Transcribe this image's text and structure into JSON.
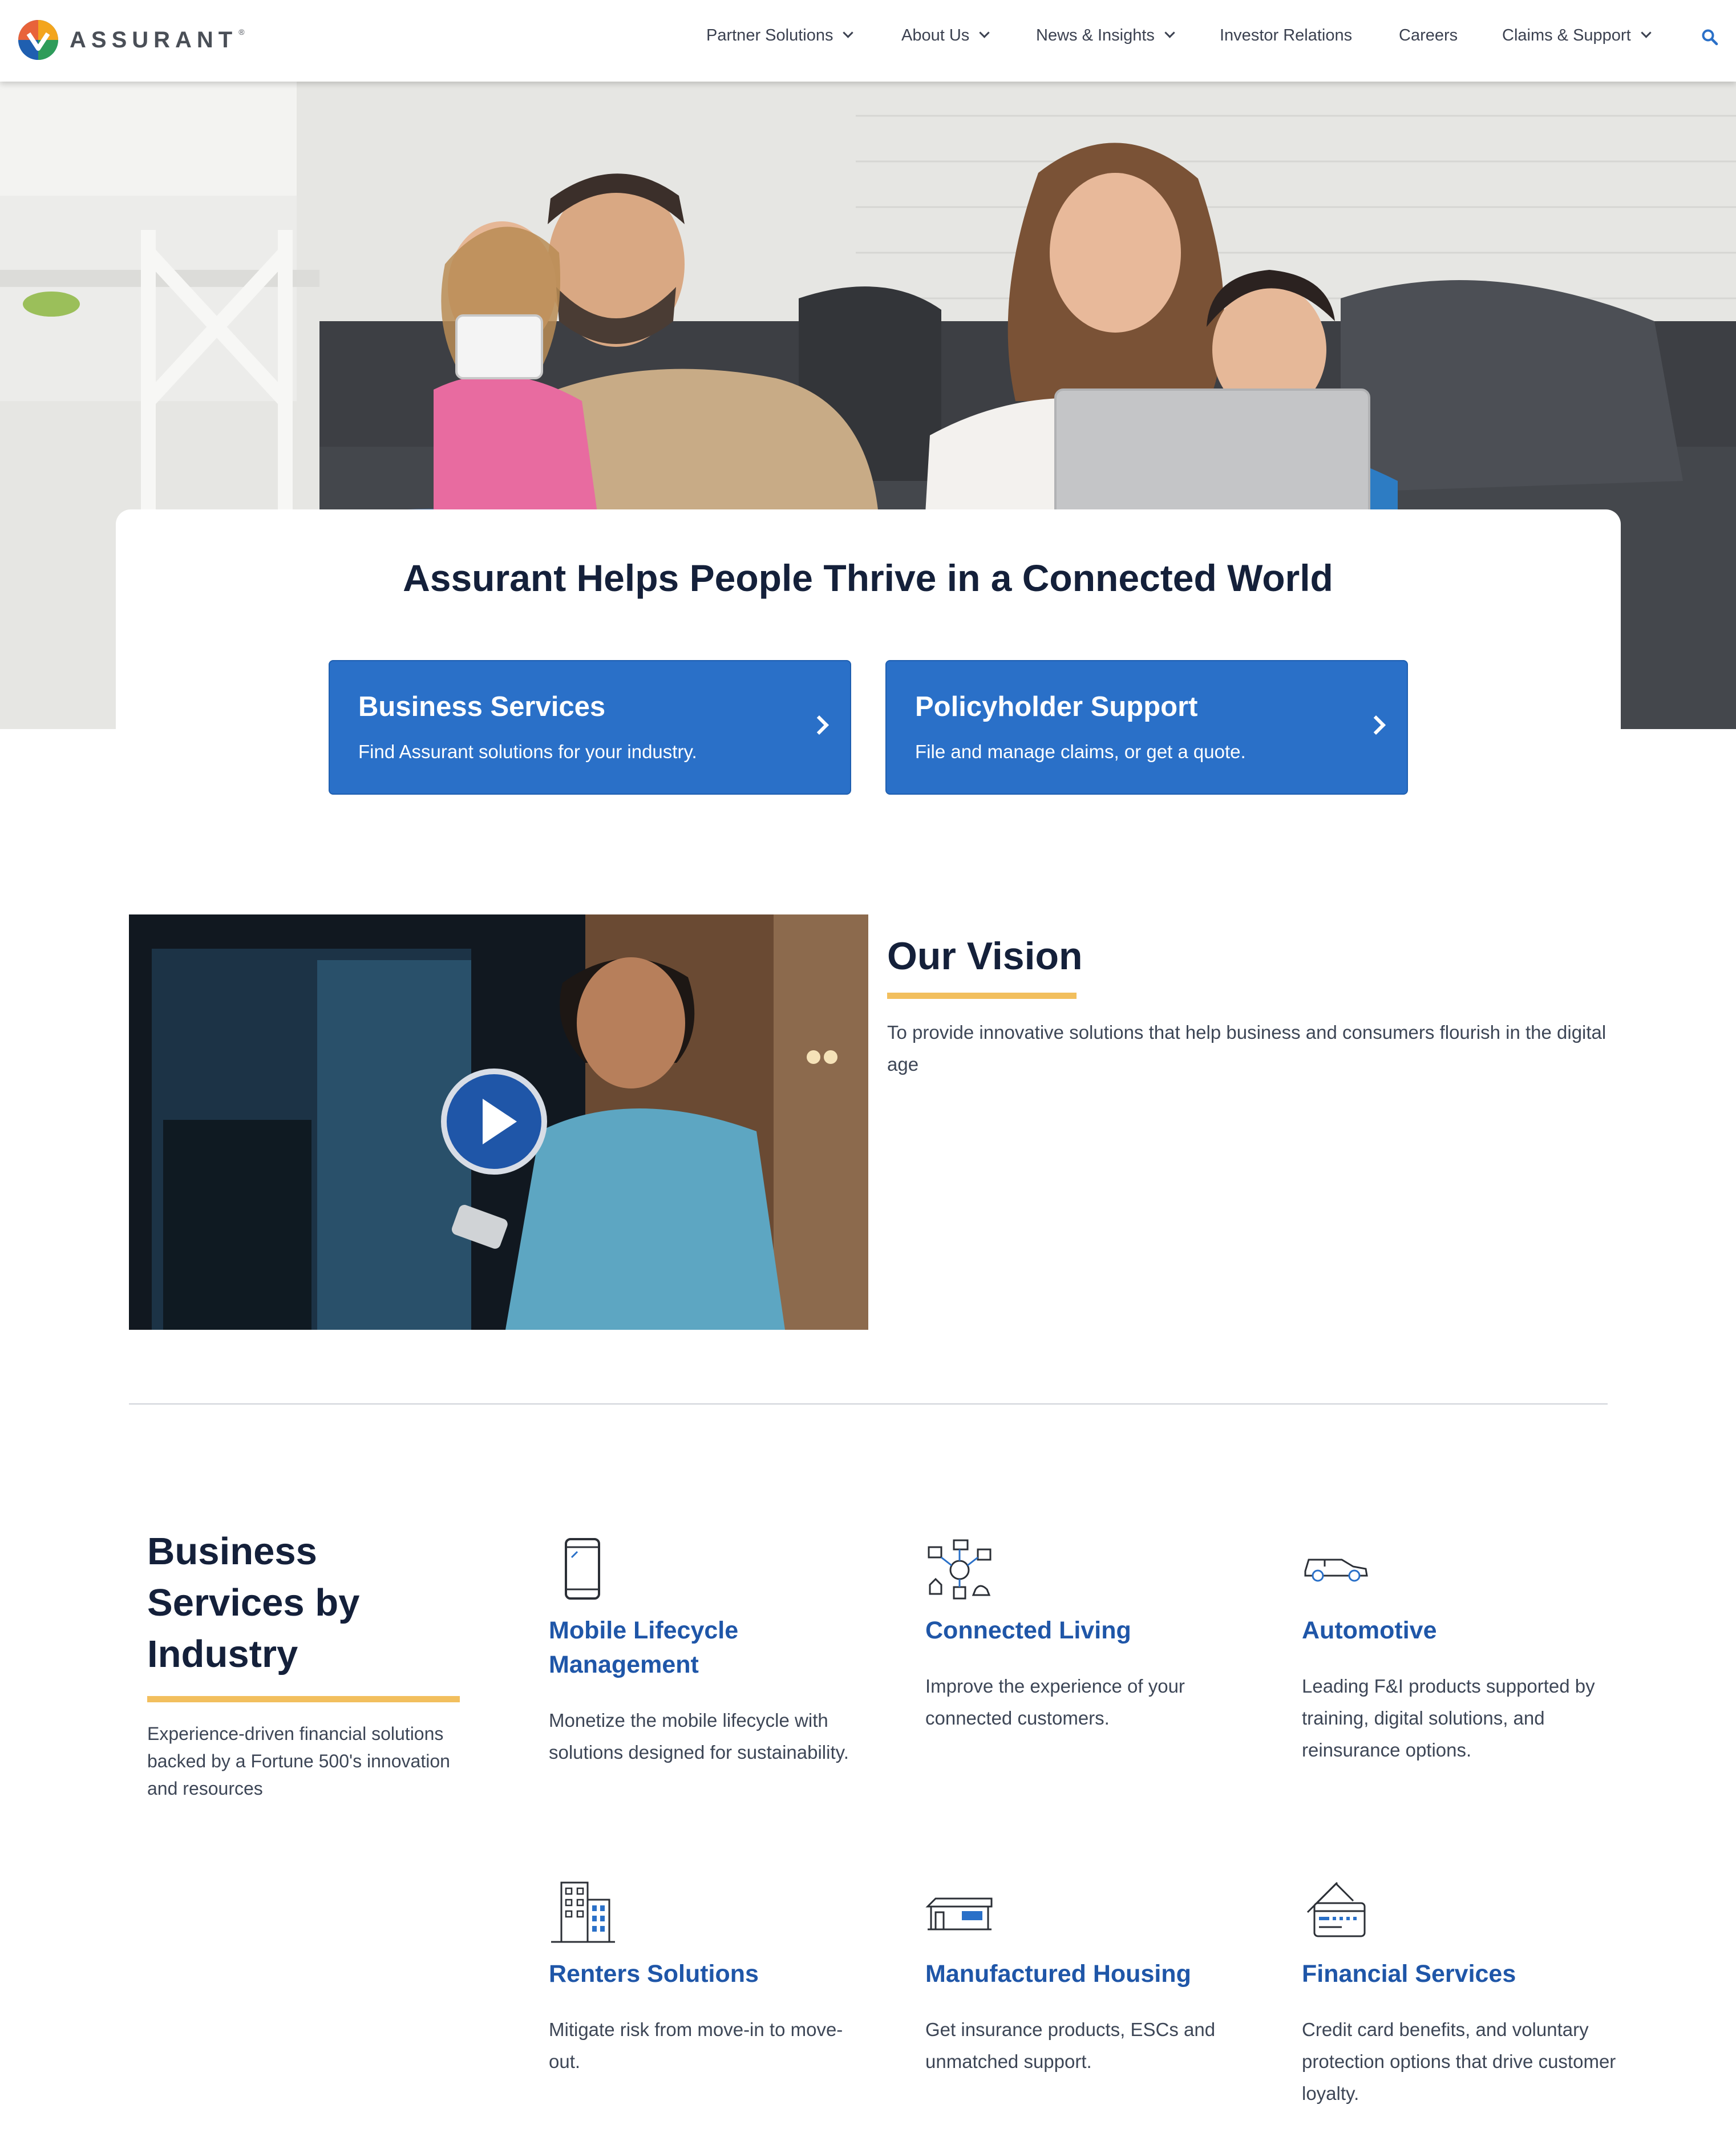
{
  "brand": {
    "name": "ASSURANT",
    "registered": "®"
  },
  "nav": {
    "items": [
      {
        "label": "Partner Solutions",
        "dropdown": true
      },
      {
        "label": "About Us",
        "dropdown": true
      },
      {
        "label": "News & Insights",
        "dropdown": true
      },
      {
        "label": "Investor Relations",
        "dropdown": false
      },
      {
        "label": "Careers",
        "dropdown": false
      },
      {
        "label": "Claims & Support",
        "dropdown": true
      }
    ],
    "search_icon": "search-icon"
  },
  "hero": {
    "title": "Assurant Helps People Thrive in a Connected World",
    "cards": [
      {
        "title": "Business Services",
        "subtitle": "Find Assurant solutions for your industry."
      },
      {
        "title": "Policyholder Support",
        "subtitle": "File and manage claims, or get a quote."
      }
    ]
  },
  "vision": {
    "title": "Our Vision",
    "text": "To provide innovative solutions that help business and consumers flourish in the digital age"
  },
  "industries": {
    "title": "Business Services by Industry",
    "subtitle": "Experience-driven financial solutions backed by a Fortune 500's innovation and resources",
    "items": [
      {
        "name": "Mobile Lifecycle Management",
        "desc": "Monetize the mobile lifecycle with solutions designed for sustainability.",
        "icon": "smartphone-icon"
      },
      {
        "name": "Connected Living",
        "desc": "Improve the experience of your connected customers.",
        "icon": "connected-devices-icon"
      },
      {
        "name": "Automotive",
        "desc": "Leading F&I products supported by training, digital solutions, and reinsurance options.",
        "icon": "car-icon"
      },
      {
        "name": "Renters Solutions",
        "desc": "Mitigate risk from move-in to move-out.",
        "icon": "apartment-building-icon"
      },
      {
        "name": "Manufactured Housing",
        "desc": "Get insurance products, ESCs and unmatched support.",
        "icon": "manufactured-home-icon"
      },
      {
        "name": "Financial Services",
        "desc": "Credit card benefits, and voluntary protection options that drive customer loyalty.",
        "icon": "credit-card-icon"
      }
    ]
  },
  "colors": {
    "primary_blue": "#2a70c8",
    "link_blue": "#1f56a8",
    "navy": "#14203a",
    "gold": "#f2bf5e"
  }
}
